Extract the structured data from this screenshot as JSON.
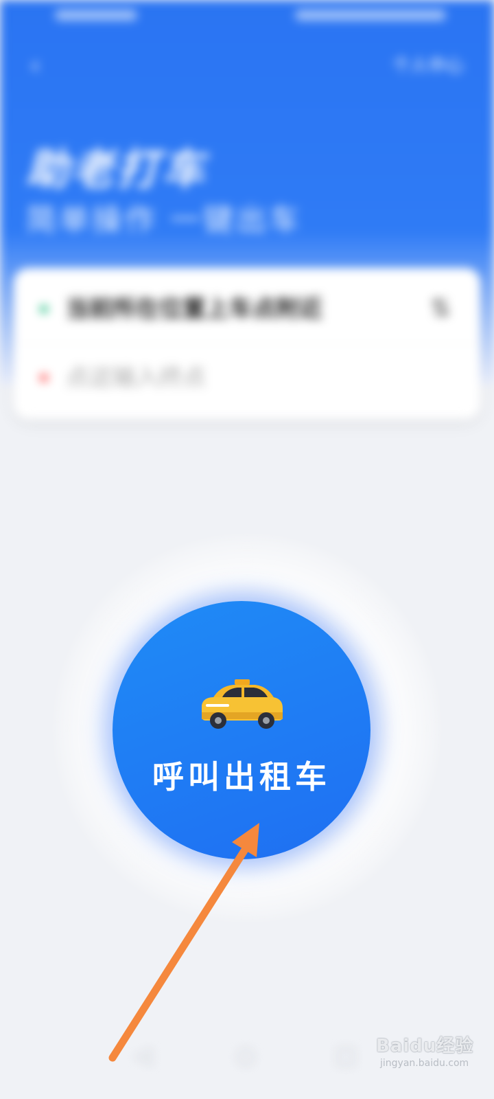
{
  "header": {
    "back_icon": "chevron-left-icon",
    "right_link": "个人中心",
    "title": "助老打车",
    "subtitle": "简单操作 一键出车"
  },
  "route_card": {
    "origin": "当前所在位置上车点附近",
    "destination": "点这输入终点",
    "swap_icon": "swap-icon"
  },
  "call_button": {
    "label": "呼叫出租车",
    "icon": "taxi-car-icon"
  },
  "watermark": {
    "main": "Baidu经验",
    "sub": "jingyan.baidu.com"
  },
  "colors": {
    "primary_blue": "#2a74f2",
    "button_blue": "#1f7af3",
    "arrow_orange": "#f5883d",
    "taxi_yellow": "#f5b82a"
  }
}
